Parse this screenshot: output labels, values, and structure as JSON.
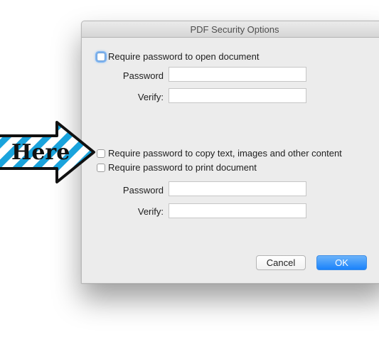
{
  "dialog": {
    "title": "PDF Security Options",
    "open_section": {
      "checkbox_label": "Require password to open document",
      "password_label": "Password",
      "verify_label": "Verify:",
      "password_value": "",
      "verify_value": ""
    },
    "permissions_section": {
      "copy_checkbox_label": "Require password to copy text, images and other content",
      "print_checkbox_label": "Require password to print document",
      "password_label": "Password",
      "verify_label": "Verify:",
      "password_value": "",
      "verify_value": ""
    },
    "buttons": {
      "cancel": "Cancel",
      "ok": "OK"
    }
  },
  "annotation": {
    "arrow_text": "Here",
    "icon": "striped-arrow-icon",
    "stripe_color": "#1aa3dc"
  },
  "colors": {
    "ok_button": "#1a82fb",
    "focus_ring": "#7eb3f0"
  }
}
